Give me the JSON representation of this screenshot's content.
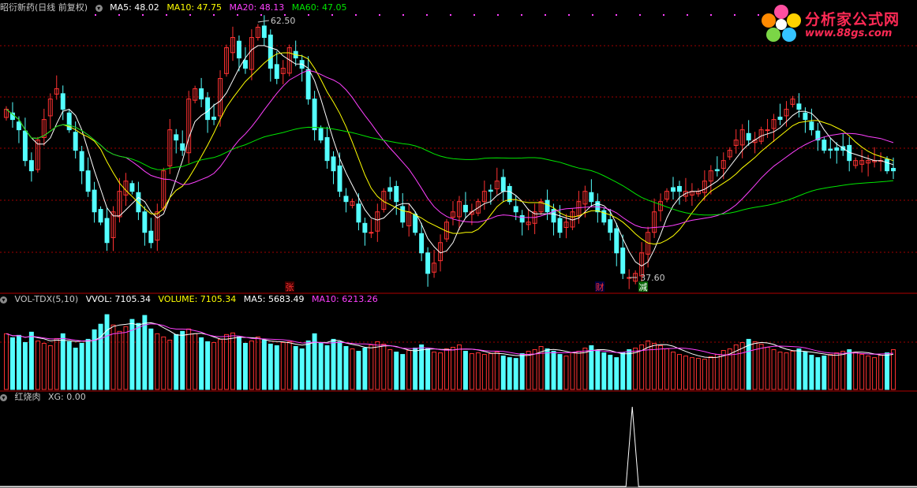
{
  "main_legend": {
    "title": "昭衍新药(日线 前复权)",
    "ma5": "MA5: 48.02",
    "ma10": "MA10: 47.75",
    "ma20": "MA20: 48.13",
    "ma60": "MA60: 47.05"
  },
  "vol_legend": {
    "name": "VOL-TDX(5,10)",
    "vvol": "VVOL: 7105.34",
    "volume": "VOLUME: 7105.34",
    "ma5": "MA5: 5683.49",
    "ma10": "MA10: 6213.26"
  },
  "ind_legend": {
    "name": "红烧肉",
    "xg": "XG: 0.00"
  },
  "annotations": {
    "high": "62.50",
    "low": "37.60",
    "mark_zhang": "张",
    "mark_cai": "财",
    "mark_jian": "减"
  },
  "logo": {
    "name": "分析家公式网",
    "url": "www.88gs.com"
  },
  "colors": {
    "up": "#ff3232",
    "down": "#54ffff",
    "ma5": "#ffffff",
    "ma10": "#ffff00",
    "ma20": "#ff40ff",
    "ma60": "#00e600",
    "grid": "#a00000",
    "legend_text": "#c8c8c8"
  },
  "chart_data": {
    "type": "candlestick",
    "price_range": [
      37.6,
      62.5
    ],
    "close": [
      54,
      53,
      52,
      49,
      48,
      51,
      53,
      55,
      56,
      54,
      52,
      50,
      48,
      46,
      44,
      43,
      41,
      44,
      46,
      47,
      46,
      44,
      42,
      41,
      44,
      48,
      52,
      51,
      50,
      55,
      56,
      55,
      53,
      53,
      57,
      60,
      61,
      59,
      58,
      61,
      62,
      61,
      58,
      57,
      58,
      60,
      59,
      58,
      55,
      52,
      51,
      49,
      48,
      46,
      45,
      45,
      43,
      42,
      42,
      44,
      46,
      46,
      45,
      43,
      44,
      42,
      40,
      38,
      39,
      41,
      43,
      44,
      45,
      44,
      44,
      45,
      46,
      46,
      47,
      46,
      45,
      44,
      43,
      43,
      44,
      45,
      44,
      43,
      42,
      43,
      44,
      45,
      46,
      45,
      44,
      43,
      42,
      40,
      38,
      37.6,
      38,
      40,
      42,
      44,
      45,
      46,
      46,
      46,
      46,
      46,
      46,
      47,
      48,
      48,
      49,
      50,
      51,
      52,
      51,
      51,
      52,
      52,
      53,
      53,
      54,
      55,
      54,
      53,
      52,
      51,
      50,
      50,
      50,
      50,
      49,
      49,
      49,
      49,
      49,
      49,
      48,
      48
    ],
    "volume": [
      7000,
      6500,
      6800,
      5900,
      7200,
      6100,
      5800,
      5500,
      6400,
      7000,
      6000,
      5200,
      5800,
      6300,
      7500,
      8200,
      9400,
      8100,
      7300,
      7900,
      8800,
      8300,
      9300,
      7600,
      7000,
      6600,
      6200,
      6900,
      7300,
      7600,
      7000,
      6500,
      6000,
      5900,
      6300,
      6900,
      7100,
      6600,
      5800,
      6100,
      6600,
      6200,
      5700,
      5500,
      5900,
      6000,
      5400,
      5100,
      6100,
      7000,
      5900,
      5500,
      6300,
      6000,
      5400,
      5100,
      4800,
      5200,
      5600,
      6000,
      5700,
      5000,
      4700,
      4400,
      4900,
      5200,
      5600,
      5100,
      4700,
      4600,
      5100,
      5300,
      5600,
      4800,
      4500,
      4600,
      4400,
      4500,
      4700,
      4200,
      4000,
      3900,
      4500,
      4800,
      5000,
      5400,
      5100,
      4800,
      4400,
      4200,
      4600,
      4800,
      5200,
      5500,
      4900,
      4600,
      4300,
      4000,
      4600,
      5000,
      5200,
      5600,
      6100,
      5800,
      5500,
      5100,
      4700,
      4400,
      4200,
      4000,
      3900,
      3800,
      4100,
      4400,
      4900,
      5100,
      5600,
      5900,
      6300,
      6000,
      5700,
      5300,
      5000,
      4700,
      4600,
      4800,
      5100,
      4700,
      4300,
      4000,
      4200,
      4400,
      4600,
      4800,
      5000,
      4700,
      4400,
      4200,
      4000,
      4300,
      4600,
      5000
    ]
  }
}
